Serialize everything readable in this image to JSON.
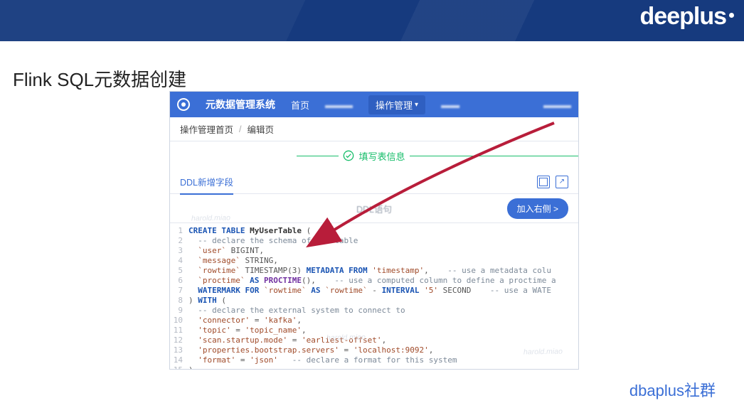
{
  "banner": {
    "brand": "deeplus"
  },
  "slide": {
    "title": "Flink SQL元数据创建"
  },
  "app": {
    "name": "元数据管理系统",
    "nav": {
      "home": "首页",
      "blur1": "▬▬▬",
      "ops_mgmt": "操作管理",
      "blur2": "▬▬",
      "blur3": "▬▬▬"
    }
  },
  "breadcrumb": {
    "a": "操作管理首页",
    "b": "编辑页"
  },
  "step": {
    "label": "填写表信息"
  },
  "tabs": {
    "ddl_add_field": "DDL新增字段"
  },
  "ddl_row": {
    "center_label": "DDL语句",
    "right_button": "加入右侧 >"
  },
  "code": {
    "lines": [
      "CREATE TABLE MyUserTable (",
      "  -- declare the schema of the table",
      "  `user` BIGINT,",
      "  `message` STRING,",
      "  `rowtime` TIMESTAMP(3) METADATA FROM 'timestamp',    -- use a metadata colu",
      "  `proctime` AS PROCTIME(),    -- use a computed column to define a proctime a",
      "  WATERMARK FOR `rowtime` AS `rowtime` - INTERVAL '5' SECOND    -- use a WATE",
      ") WITH (",
      "  -- declare the external system to connect to",
      "  'connector' = 'kafka',",
      "  'topic' = 'topic_name',",
      "  'scan.startup.mode' = 'earliest-offset',",
      "  'properties.bootstrap.servers' = 'localhost:9092',",
      "  'format' = 'json'   -- declare a format for this system",
      ")"
    ]
  },
  "watermarks": {
    "wm": "harold.miao"
  },
  "footer": {
    "mark": "dbaplus社群"
  }
}
